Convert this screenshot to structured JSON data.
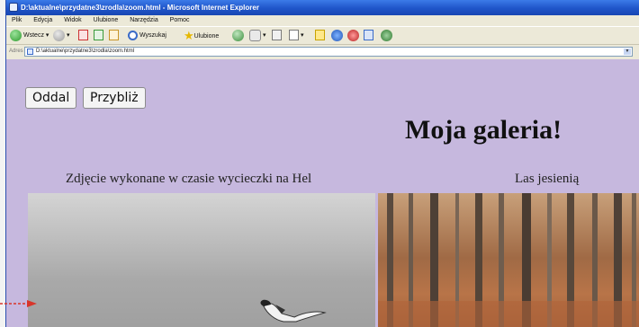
{
  "window": {
    "title": "D:\\aktualne\\przydatne3\\zrodla\\zoom.html - Microsoft Internet Explorer"
  },
  "menu": [
    "Plik",
    "Edycja",
    "Widok",
    "Ulubione",
    "Narzędzia",
    "Pomoc"
  ],
  "toolbar": {
    "back": "Wstecz",
    "search": "Wyszukaj",
    "favorites": "Ulubione"
  },
  "address": {
    "label": "Adres",
    "value": "D:\\aktualne\\przydatne3\\zrodla\\zoom.html"
  },
  "page": {
    "buttons": {
      "zoom_out": "Oddal",
      "zoom_in": "Przybliż"
    },
    "heading": "Moja galeria!",
    "photos": [
      {
        "caption": "Zdjęcie wykonane w czasie wycieczki na Hel"
      },
      {
        "caption": "Las jesienią"
      }
    ]
  },
  "colors": {
    "page_background": "#c6b8de",
    "titlebar": "#1f55c9"
  }
}
